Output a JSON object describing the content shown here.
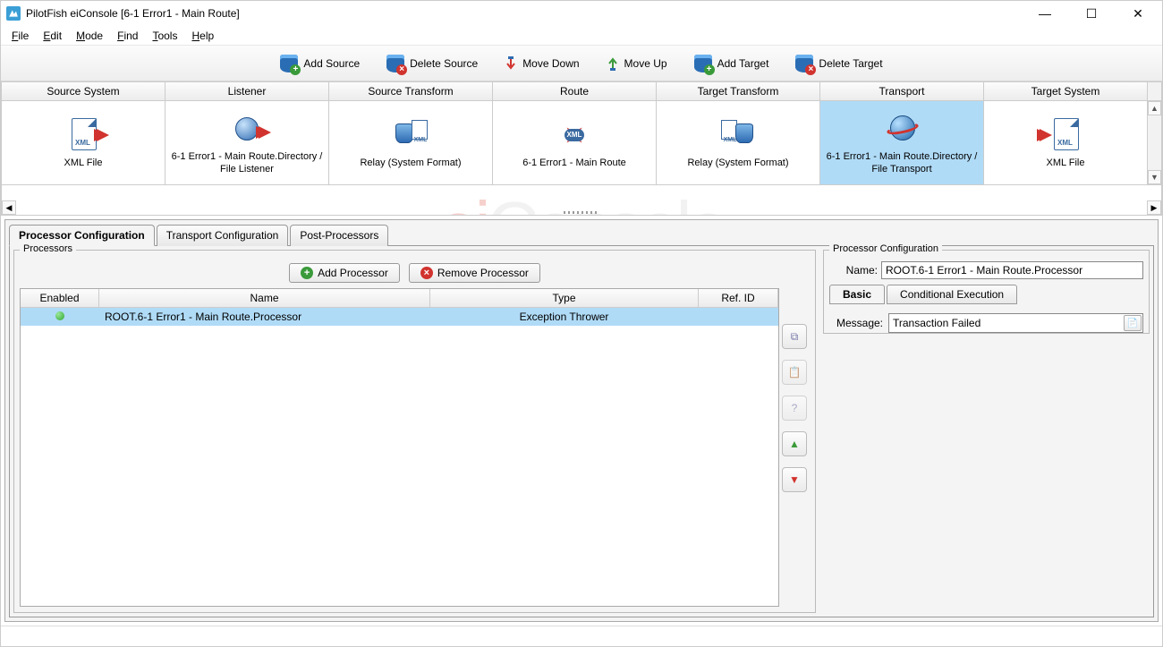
{
  "window": {
    "title": "PilotFish eiConsole [6-1 Error1 - Main Route]"
  },
  "menubar": {
    "file": "File",
    "edit": "Edit",
    "mode": "Mode",
    "find": "Find",
    "tools": "Tools",
    "help": "Help"
  },
  "toolbar": {
    "add_source": "Add Source",
    "delete_source": "Delete Source",
    "move_down": "Move Down",
    "move_up": "Move Up",
    "add_target": "Add Target",
    "delete_target": "Delete Target"
  },
  "stages": {
    "headers": {
      "source_system": "Source System",
      "listener": "Listener",
      "source_transform": "Source Transform",
      "route": "Route",
      "target_transform": "Target Transform",
      "transport": "Transport",
      "target_system": "Target System"
    },
    "cells": {
      "source_system": "XML File",
      "listener": "6-1 Error1 - Main Route.Directory / File Listener",
      "source_transform": "Relay (System Format)",
      "route": "6-1 Error1 - Main Route",
      "target_transform": "Relay (System Format)",
      "transport": "6-1 Error1 - Main Route.Directory / File Transport",
      "target_system": "XML File"
    }
  },
  "tabs": {
    "processor_config": "Processor Configuration",
    "transport_config": "Transport Configuration",
    "post_processors": "Post-Processors"
  },
  "processors_panel": {
    "legend": "Processors",
    "add_btn": "Add Processor",
    "remove_btn": "Remove Processor",
    "columns": {
      "enabled": "Enabled",
      "name": "Name",
      "type": "Type",
      "ref": "Ref. ID"
    },
    "rows": [
      {
        "enabled": true,
        "name": "ROOT.6-1 Error1 - Main Route.Processor",
        "type": "Exception Thrower",
        "ref": ""
      }
    ]
  },
  "config_panel": {
    "legend": "Processor Configuration",
    "name_label": "Name:",
    "name_value": "ROOT.6-1 Error1 - Main Route.Processor",
    "subtabs": {
      "basic": "Basic",
      "conditional": "Conditional Execution"
    },
    "message_label": "Message:",
    "message_value": "Transaction Failed"
  }
}
